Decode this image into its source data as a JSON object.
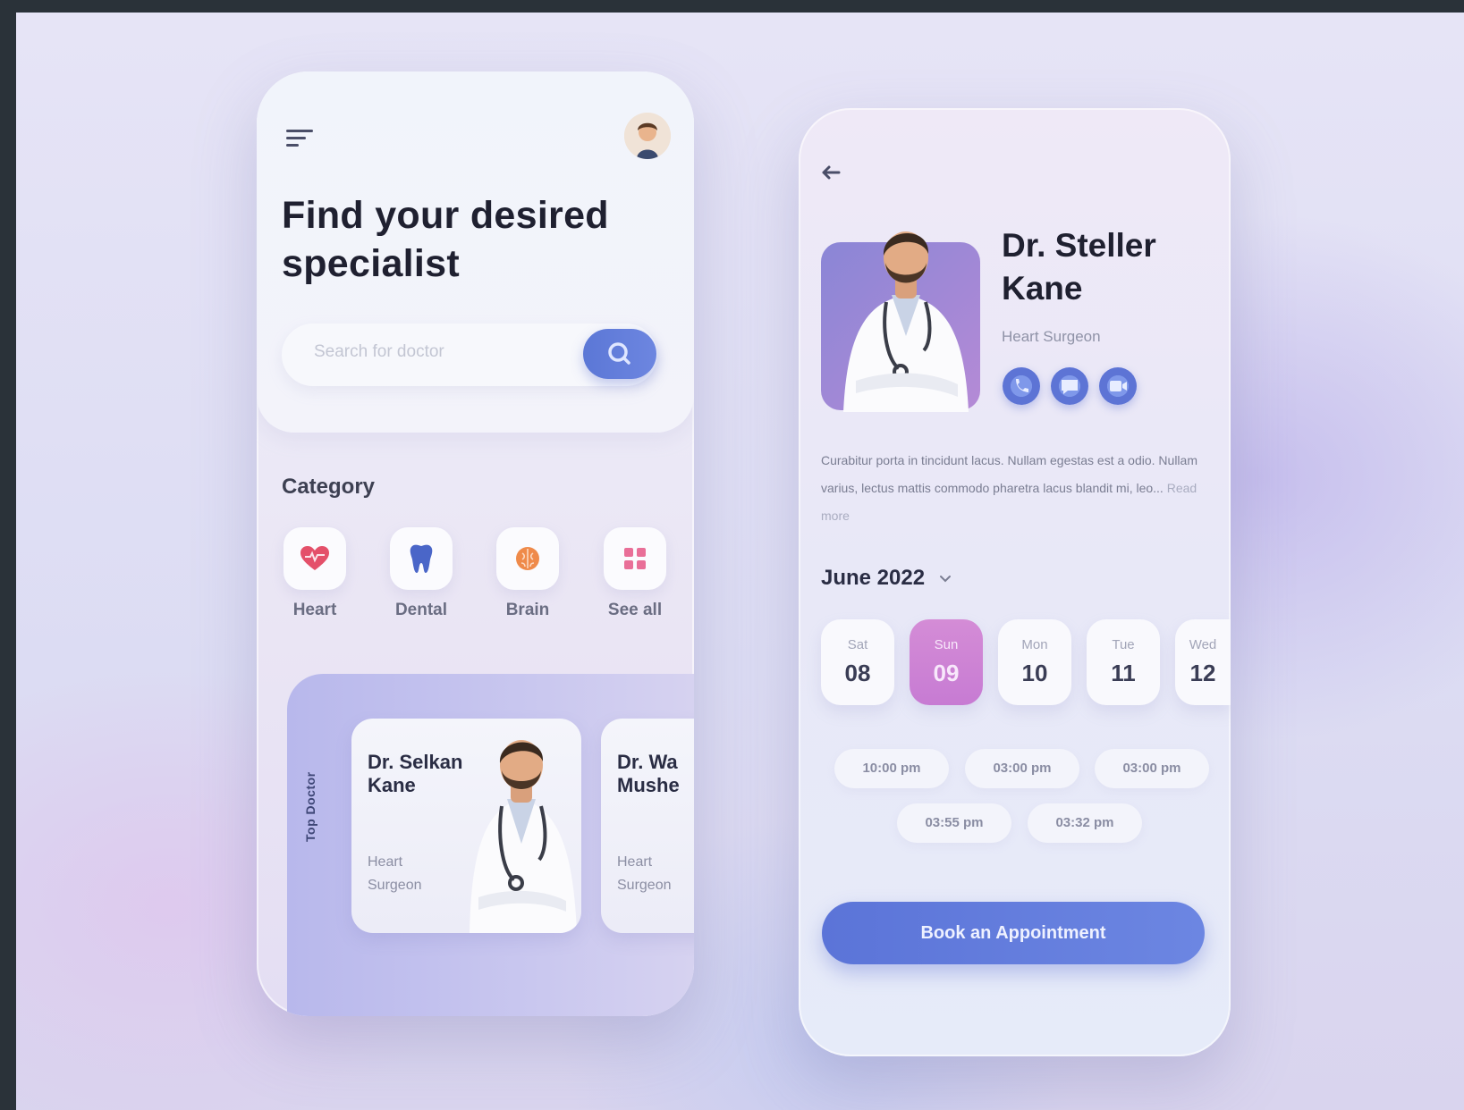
{
  "colors": {
    "accent": "#5b74d8",
    "selected_date": "#d48cd6",
    "heading": "#1f2030"
  },
  "left_screen": {
    "menu_icon": "hamburger-menu-icon",
    "headline": "Find your desired specialist",
    "search": {
      "placeholder": "Search for doctor",
      "icon": "search-icon"
    },
    "category": {
      "title": "Category",
      "items": [
        {
          "label": "Heart",
          "icon": "heart-icon",
          "color": "#e4506a"
        },
        {
          "label": "Dental",
          "icon": "tooth-icon",
          "color": "#4a66c8"
        },
        {
          "label": "Brain",
          "icon": "brain-icon",
          "color": "#ef8a4a"
        },
        {
          "label": "See all",
          "icon": "grid-icon",
          "color": "#e96f98"
        }
      ]
    },
    "top_doctors": {
      "label": "Top Doctor",
      "cards": [
        {
          "name": "Dr. Selkan Kane",
          "specialty": "Heart Surgeon"
        },
        {
          "name": "Dr. Wa Mushe",
          "specialty": "Heart Surgeon"
        }
      ]
    }
  },
  "right_screen": {
    "back_icon": "arrow-left-icon",
    "doctor": {
      "name": "Dr. Steller Kane",
      "specialty": "Heart Surgeon"
    },
    "contact_icons": [
      "phone-icon",
      "chat-icon",
      "video-icon"
    ],
    "bio": "Curabitur porta in tincidunt lacus. Nullam egestas est a odio. Nullam varius, lectus mattis commodo pharetra lacus blandit mi, leo...",
    "read_more": "Read more",
    "month": "June 2022",
    "dates": [
      {
        "day": "Sat",
        "num": "08",
        "selected": false
      },
      {
        "day": "Sun",
        "num": "09",
        "selected": true
      },
      {
        "day": "Mon",
        "num": "10",
        "selected": false
      },
      {
        "day": "Tue",
        "num": "11",
        "selected": false
      },
      {
        "day": "Wed",
        "num": "12",
        "selected": false
      }
    ],
    "times": [
      "10:00 pm",
      "03:00 pm",
      "03:00 pm",
      "03:55 pm",
      "03:32 pm"
    ],
    "book_button": "Book an Appointment"
  }
}
